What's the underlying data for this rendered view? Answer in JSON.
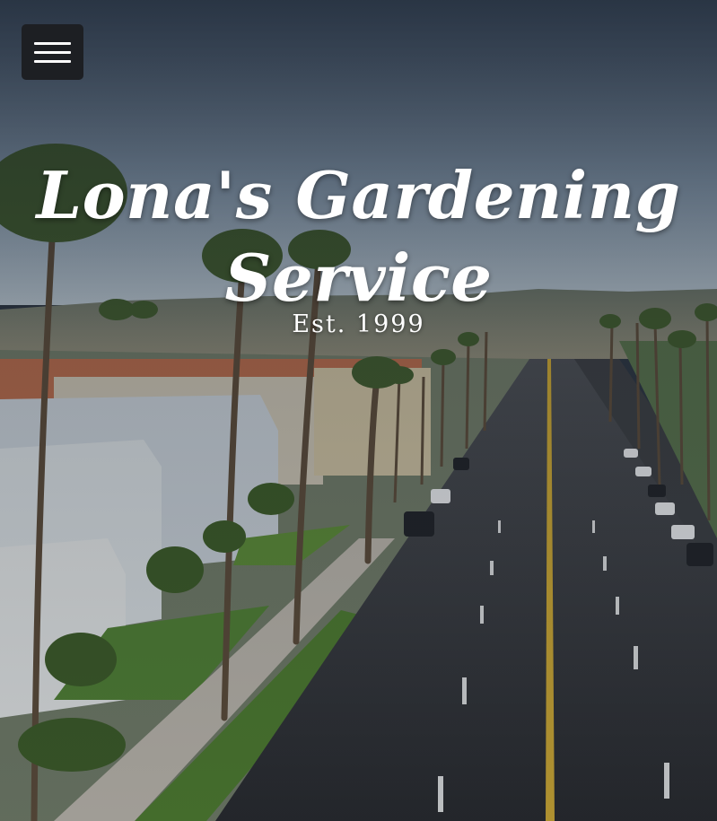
{
  "hero": {
    "title_line1": "Lona's Gardening",
    "title_line2": "Service",
    "subtitle": "Est. 1999",
    "background_image": "aerial-street-palm-trees-photo"
  },
  "menu": {
    "icon": "hamburger-menu-icon"
  },
  "colors": {
    "menu_bg": "#1d1f23",
    "text": "#ffffff",
    "sky": "#5a7189",
    "road": "#2f3236",
    "road_line": "#d8b43a"
  }
}
